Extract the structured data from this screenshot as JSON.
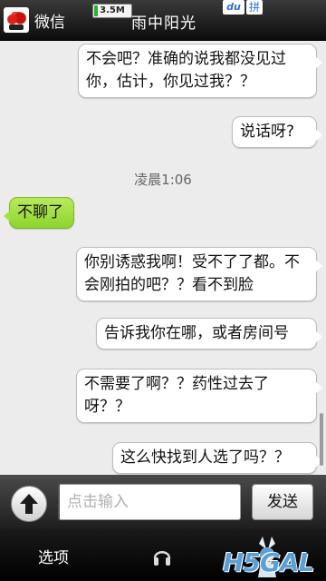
{
  "status_bar": {
    "app_name": "微信",
    "memory_indicator": "3.5M",
    "contact_name": "雨中阳光",
    "ime_badge": "du",
    "ime_mode": "拼"
  },
  "chat": {
    "messages": [
      {
        "direction": "out",
        "text": "不会吧？准确的说我都没见过你，估计，你见过我？？"
      },
      {
        "direction": "out",
        "text": "说话呀?"
      },
      {
        "type": "timestamp",
        "text": "凌晨1:06"
      },
      {
        "direction": "in",
        "text": "不聊了"
      },
      {
        "direction": "out",
        "text": "你别诱惑我啊！受不了了都。不会刚拍的吧？？看不到脸"
      },
      {
        "direction": "out",
        "text": "告诉我你在哪，或者房间号"
      },
      {
        "direction": "out",
        "text": "不需要了啊？？药性过去了呀？？"
      },
      {
        "direction": "out",
        "text": "这么快找到人选了吗？？"
      }
    ]
  },
  "input_bar": {
    "placeholder": "点击输入",
    "value": "",
    "send_label": "发送"
  },
  "softkeys": {
    "left_label": "选项",
    "center_icon": "headset-icon"
  },
  "watermark": {
    "text": "H5GAL"
  },
  "colors": {
    "incoming_bubble": "#9adb3c",
    "outgoing_bubble": "#ffffff",
    "background": "#ececec",
    "bars": "#1e1e1e"
  }
}
